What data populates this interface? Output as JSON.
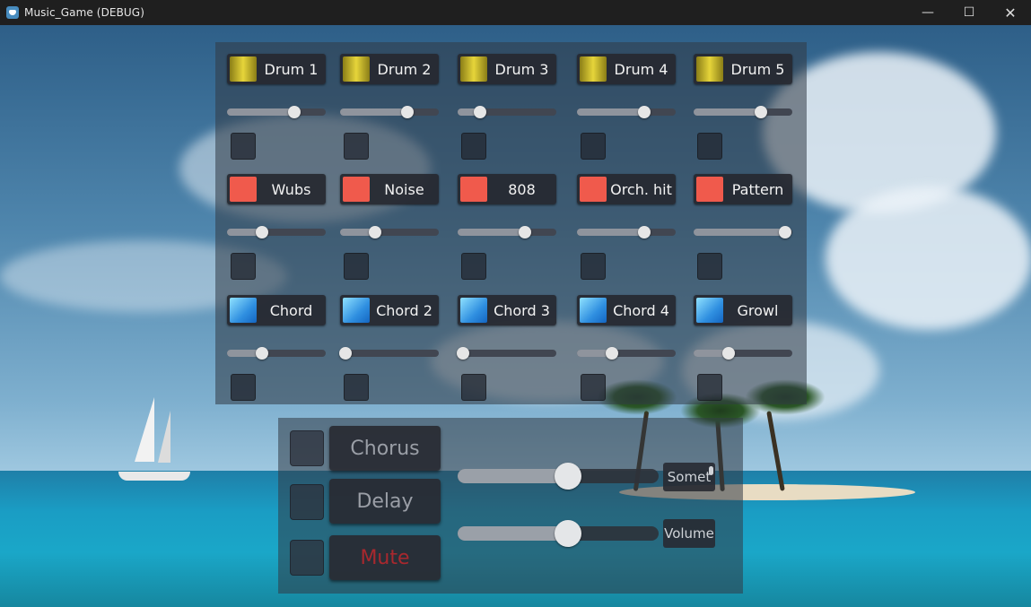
{
  "window": {
    "title": "Music_Game (DEBUG)",
    "controls": {
      "minimize": "—",
      "maximize": "☐",
      "close": "✕"
    }
  },
  "instruments": [
    {
      "label": "Drum 1",
      "swatch": "yellow",
      "volume": 0.68
    },
    {
      "label": "Drum 2",
      "swatch": "yellow",
      "volume": 0.68
    },
    {
      "label": "Drum 3",
      "swatch": "yellow",
      "volume": 0.23
    },
    {
      "label": "Drum 4",
      "swatch": "yellow",
      "volume": 0.68
    },
    {
      "label": "Drum 5",
      "swatch": "yellow",
      "volume": 0.68
    },
    {
      "label": "Wubs",
      "swatch": "red",
      "volume": 0.35
    },
    {
      "label": "Noise",
      "swatch": "red",
      "volume": 0.35
    },
    {
      "label": "808",
      "swatch": "red",
      "volume": 0.68
    },
    {
      "label": "Orch. hit",
      "swatch": "red",
      "volume": 0.68
    },
    {
      "label": "Pattern",
      "swatch": "red",
      "volume": 0.93
    },
    {
      "label": "Chord",
      "swatch": "blue",
      "volume": 0.35
    },
    {
      "label": "Chord 2",
      "swatch": "blue",
      "volume": 0.05
    },
    {
      "label": "Chord 3",
      "swatch": "blue",
      "volume": 0.05
    },
    {
      "label": "Chord 4",
      "swatch": "blue",
      "volume": 0.35
    },
    {
      "label": "Growl",
      "swatch": "blue",
      "volume": 0.35
    }
  ],
  "effects": {
    "chorus_label": "Chorus",
    "delay_label": "Delay",
    "mute_label": "Mute",
    "top_slider_value": 0.55,
    "volume_slider_value": 0.55,
    "top_tag_label": "Somet",
    "volume_tag_label": "Volume"
  },
  "colors": {
    "yellow": "#e6d53a",
    "red": "#f05a4c",
    "blue": "#2f8fe0",
    "mute_text": "#a8282e"
  }
}
